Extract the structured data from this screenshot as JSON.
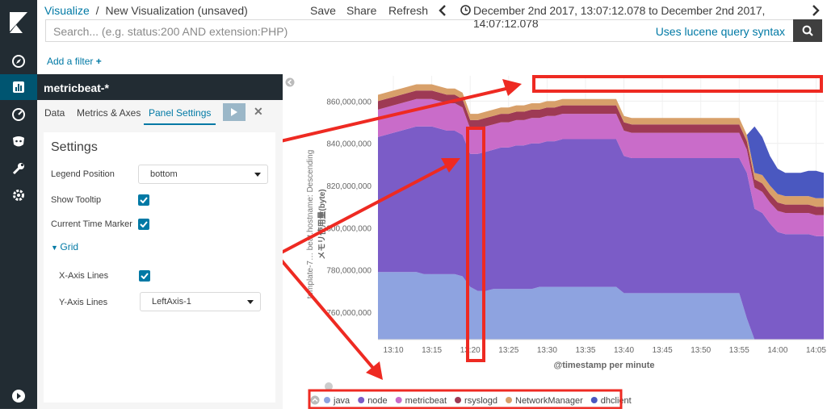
{
  "breadcrumb": {
    "app": "Visualize",
    "sep": "/",
    "current": "New Visualization (unsaved)"
  },
  "top_menu": {
    "save": "Save",
    "share": "Share",
    "refresh": "Refresh",
    "time_range": "December 2nd 2017, 13:07:12.078 to December 2nd 2017, 14:07:12.078"
  },
  "search": {
    "placeholder": "Search... (e.g. status:200 AND extension:PHP)",
    "syntax_link": "Uses lucene query syntax"
  },
  "filter": {
    "add_label": "Add a filter"
  },
  "editor": {
    "title": "metricbeat-*",
    "tabs": [
      "Data",
      "Metrics & Axes",
      "Panel Settings"
    ],
    "settings_heading": "Settings",
    "legend_position_label": "Legend Position",
    "legend_position_value": "bottom",
    "show_tooltip_label": "Show Tooltip",
    "current_time_marker_label": "Current Time Marker",
    "grid_heading": "Grid",
    "x_axis_lines_label": "X-Axis Lines",
    "y_axis_lines_label": "Y-Axis Lines",
    "y_axis_lines_value": "LeftAxis-1"
  },
  "nav_icons": [
    "discover-icon",
    "visualize-icon",
    "dashboard-icon",
    "timelion-icon",
    "devtools-icon",
    "management-icon",
    "collapse-icon"
  ],
  "colors": {
    "accent": "#0079a5",
    "nav": "#222c33",
    "annotation": "#ee2a22"
  },
  "chart_data": {
    "type": "area",
    "x": [
      "13:08",
      "13:09",
      "13:10",
      "13:11",
      "13:12",
      "13:13",
      "13:14",
      "13:15",
      "13:16",
      "13:17",
      "13:18",
      "13:19",
      "13:20",
      "13:21",
      "13:22",
      "13:23",
      "13:24",
      "13:25",
      "13:26",
      "13:27",
      "13:28",
      "13:29",
      "13:30",
      "13:31",
      "13:32",
      "13:33",
      "13:34",
      "13:35",
      "13:36",
      "13:37",
      "13:38",
      "13:39",
      "13:40",
      "13:41",
      "13:42",
      "13:43",
      "13:44",
      "13:45",
      "13:46",
      "13:47",
      "13:48",
      "13:49",
      "13:50",
      "13:51",
      "13:52",
      "13:53",
      "13:54",
      "13:55",
      "13:56",
      "13:57",
      "13:58",
      "13:59",
      "14:00",
      "14:01",
      "14:02",
      "14:03",
      "14:04",
      "14:05",
      "14:06"
    ],
    "xticks": [
      "13:10",
      "13:15",
      "13:20",
      "13:25",
      "13:30",
      "13:35",
      "13:40",
      "13:45",
      "13:50",
      "13:55",
      "14:00",
      "14:05"
    ],
    "yticks": [
      760000000,
      780000000,
      800000000,
      820000000,
      840000000,
      860000000
    ],
    "ytick_labels": [
      "760,000,000",
      "780,000,000",
      "800,000,000",
      "820,000,000",
      "840,000,000",
      "860,000,000"
    ],
    "ylim": [
      747000000,
      872000000
    ],
    "xlabel": "@timestamp per minute",
    "ylabel": "template-7… beat.hostname: Descending",
    "ylabel2": "メモリ使用量(byte)",
    "series": [
      {
        "name": "java",
        "color": "#8ea3e0",
        "values": [
          779,
          779,
          779,
          779,
          779,
          779,
          778,
          778,
          778,
          778,
          778,
          777,
          772,
          770,
          770,
          771,
          771,
          771,
          771,
          771,
          771,
          772,
          772,
          772,
          772,
          772,
          772,
          772,
          772,
          772,
          772,
          772,
          769,
          769,
          769,
          769,
          769,
          769,
          769,
          769,
          769,
          769,
          769,
          769,
          769,
          769,
          769,
          769,
          757,
          747,
          747,
          747,
          747,
          747,
          747,
          747,
          747,
          747,
          747
        ]
      },
      {
        "name": "node",
        "color": "#7b5cc7",
        "values": [
          64,
          65,
          66,
          67,
          68,
          69,
          70,
          70,
          69,
          68,
          68,
          67,
          63,
          65,
          66,
          66,
          67,
          67,
          68,
          68,
          69,
          68,
          69,
          69,
          70,
          70,
          70,
          70,
          70,
          70,
          70,
          70,
          65,
          64,
          64,
          64,
          64,
          64,
          64,
          64,
          64,
          64,
          64,
          64,
          64,
          64,
          64,
          64,
          69,
          62,
          60,
          55,
          51,
          50,
          50,
          50,
          50,
          49,
          49
        ]
      },
      {
        "name": "metricbeat",
        "color": "#c96cc9",
        "values": [
          13,
          13,
          13,
          13,
          13,
          13,
          13,
          13,
          13,
          13,
          13,
          13,
          12,
          12,
          12,
          12,
          12,
          12,
          12,
          12,
          12,
          12,
          12,
          12,
          12,
          12,
          12,
          12,
          12,
          12,
          12,
          12,
          12,
          12,
          12,
          12,
          12,
          12,
          12,
          12,
          12,
          12,
          12,
          12,
          12,
          12,
          12,
          12,
          11,
          10,
          10,
          10,
          10,
          10,
          10,
          10,
          10,
          10,
          10
        ]
      },
      {
        "name": "rsyslogd",
        "color": "#9e3a54",
        "values": [
          4,
          4,
          4,
          4,
          4,
          4,
          4,
          4,
          4,
          4,
          4,
          4,
          4,
          4,
          4,
          4,
          4,
          4,
          4,
          4,
          4,
          4,
          4,
          4,
          4,
          4,
          4,
          4,
          4,
          4,
          4,
          4,
          4,
          4,
          4,
          4,
          4,
          4,
          4,
          4,
          4,
          4,
          4,
          4,
          4,
          4,
          4,
          4,
          4,
          4,
          4,
          4,
          4,
          4,
          4,
          4,
          4,
          4,
          4
        ]
      },
      {
        "name": "NetworkManager",
        "color": "#d8a06a",
        "values": [
          3,
          3,
          3,
          3,
          3,
          3,
          3,
          3,
          3,
          3,
          3,
          3,
          3,
          3,
          3,
          3,
          3,
          3,
          3,
          3,
          3,
          3,
          3,
          3,
          3,
          3,
          3,
          3,
          3,
          3,
          3,
          3,
          3,
          3,
          3,
          3,
          3,
          3,
          3,
          3,
          3,
          3,
          3,
          3,
          3,
          3,
          3,
          3,
          3,
          3,
          4,
          4,
          4,
          4,
          4,
          4,
          4,
          4,
          4
        ]
      },
      {
        "name": "dhclient",
        "color": "#4a58c0",
        "values": [
          0,
          0,
          0,
          0,
          0,
          0,
          0,
          0,
          0,
          0,
          0,
          0,
          0,
          0,
          0,
          0,
          0,
          0,
          0,
          0,
          0,
          0,
          0,
          0,
          0,
          0,
          0,
          0,
          0,
          0,
          0,
          0,
          0,
          0,
          0,
          0,
          0,
          0,
          0,
          0,
          0,
          0,
          0,
          0,
          0,
          0,
          0,
          0,
          0,
          22,
          18,
          14,
          12,
          11,
          11,
          11,
          12,
          13,
          12
        ]
      }
    ]
  }
}
